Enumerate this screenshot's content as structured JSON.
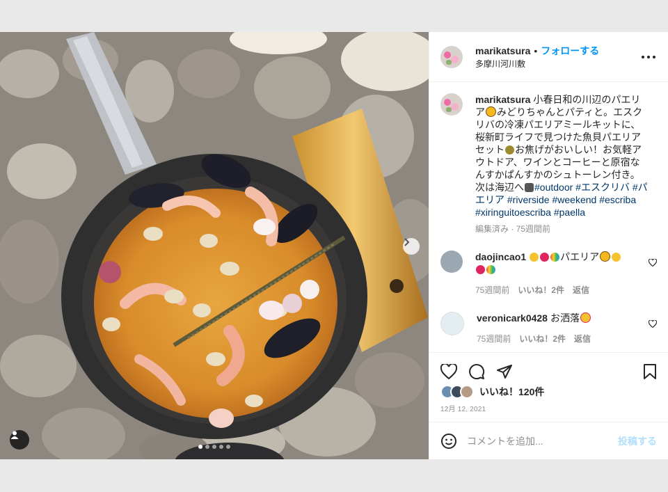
{
  "header": {
    "username": "marikatsura",
    "separator": "•",
    "follow_label": "フォローする",
    "location": "多摩川河川敷",
    "more_icon": "more-horizontal-icon"
  },
  "caption": {
    "username": "marikatsura",
    "text_1": "小春日和の川辺のパエリア",
    "text_2": "みどりちゃんとパティと。エスクリバの冷凍パエリアミールキットに、桜新町ライフで見つけた魚貝パエリアセット",
    "text_3": "お焦げがおいしい！お気軽アウトドア、ワインとコーヒーと原宿なんすかぱんすかのシュトーレン付き。次は海辺へ",
    "hashtags": [
      "#outdoor",
      "#エスクリバ",
      "#パエリア",
      "#riverside",
      "#weekend",
      "#escriba",
      "#xiringuitoescriba",
      "#paella"
    ],
    "meta": "編集済み · 75週間前"
  },
  "comments": [
    {
      "username": "daojincao1",
      "text": "パエリア",
      "time": "75週間前",
      "likes": "いいね！2件",
      "reply": "返信"
    },
    {
      "username": "veronicark0428",
      "text": "お洒落",
      "time": "75週間前",
      "likes": "いいね！2件",
      "reply": "返信"
    }
  ],
  "actions": {
    "like_icon": "heart-icon",
    "comment_icon": "comment-icon",
    "share_icon": "send-icon",
    "save_icon": "bookmark-icon",
    "likes_label": "いいね！120件",
    "date": "12月 12, 2021"
  },
  "add_comment": {
    "placeholder": "コメントを追加...",
    "post_label": "投稿する"
  },
  "carousel": {
    "total": 5,
    "active": 1
  },
  "colors": {
    "accent": "#0095f6",
    "hashtag": "#00376b",
    "muted": "#8e8e8e"
  }
}
